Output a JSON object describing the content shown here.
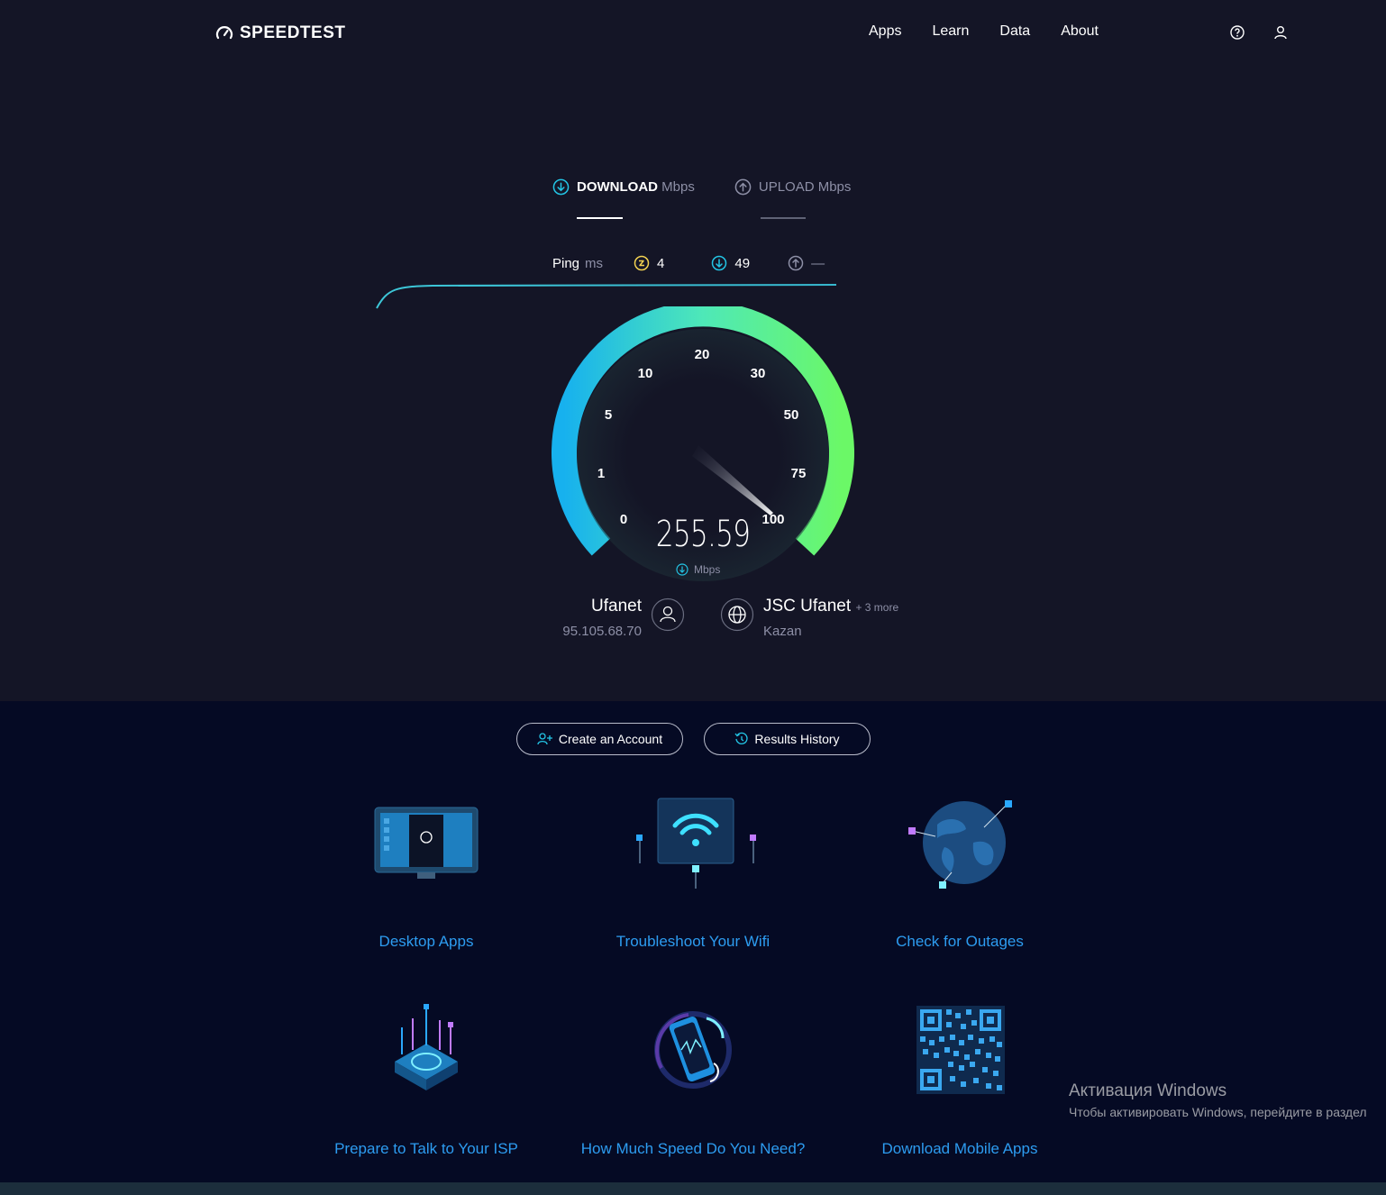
{
  "brand": {
    "name": "SPEEDTEST"
  },
  "nav": {
    "items": [
      "Apps",
      "Learn",
      "Data",
      "About"
    ]
  },
  "tabs": {
    "download_label": "DOWNLOAD",
    "download_unit": "Mbps",
    "upload_label": "UPLOAD",
    "upload_unit": "Mbps"
  },
  "ping": {
    "label": "Ping",
    "unit": "ms",
    "idle": "4",
    "download": "49",
    "upload": "—"
  },
  "gauge": {
    "ticks": [
      "0",
      "1",
      "5",
      "10",
      "20",
      "30",
      "50",
      "75",
      "100"
    ],
    "value": "255.59",
    "unit": "Mbps",
    "needle_fraction": 1.0
  },
  "client": {
    "isp": "Ufanet",
    "ip": "95.105.68.70"
  },
  "server": {
    "name": "JSC Ufanet",
    "more": "+ 3 more",
    "location": "Kazan"
  },
  "actions": {
    "create_account": "Create an Account",
    "results_history": "Results History"
  },
  "cards": [
    {
      "label": "Desktop Apps"
    },
    {
      "label": "Troubleshoot Your Wifi"
    },
    {
      "label": "Check for Outages"
    },
    {
      "label": "Prepare to Talk to Your ISP"
    },
    {
      "label": "How Much Speed Do You Need?"
    },
    {
      "label": "Download Mobile Apps"
    }
  ],
  "windows_activation": {
    "title": "Активация Windows",
    "subtitle": "Чтобы активировать Windows, перейдите в раздел"
  },
  "colors": {
    "accent_cyan": "#23c5e5",
    "accent_green": "#6cf76a",
    "link_blue": "#2d9cf0",
    "bg_top": "#141526",
    "bg_bottom": "#050a24"
  }
}
